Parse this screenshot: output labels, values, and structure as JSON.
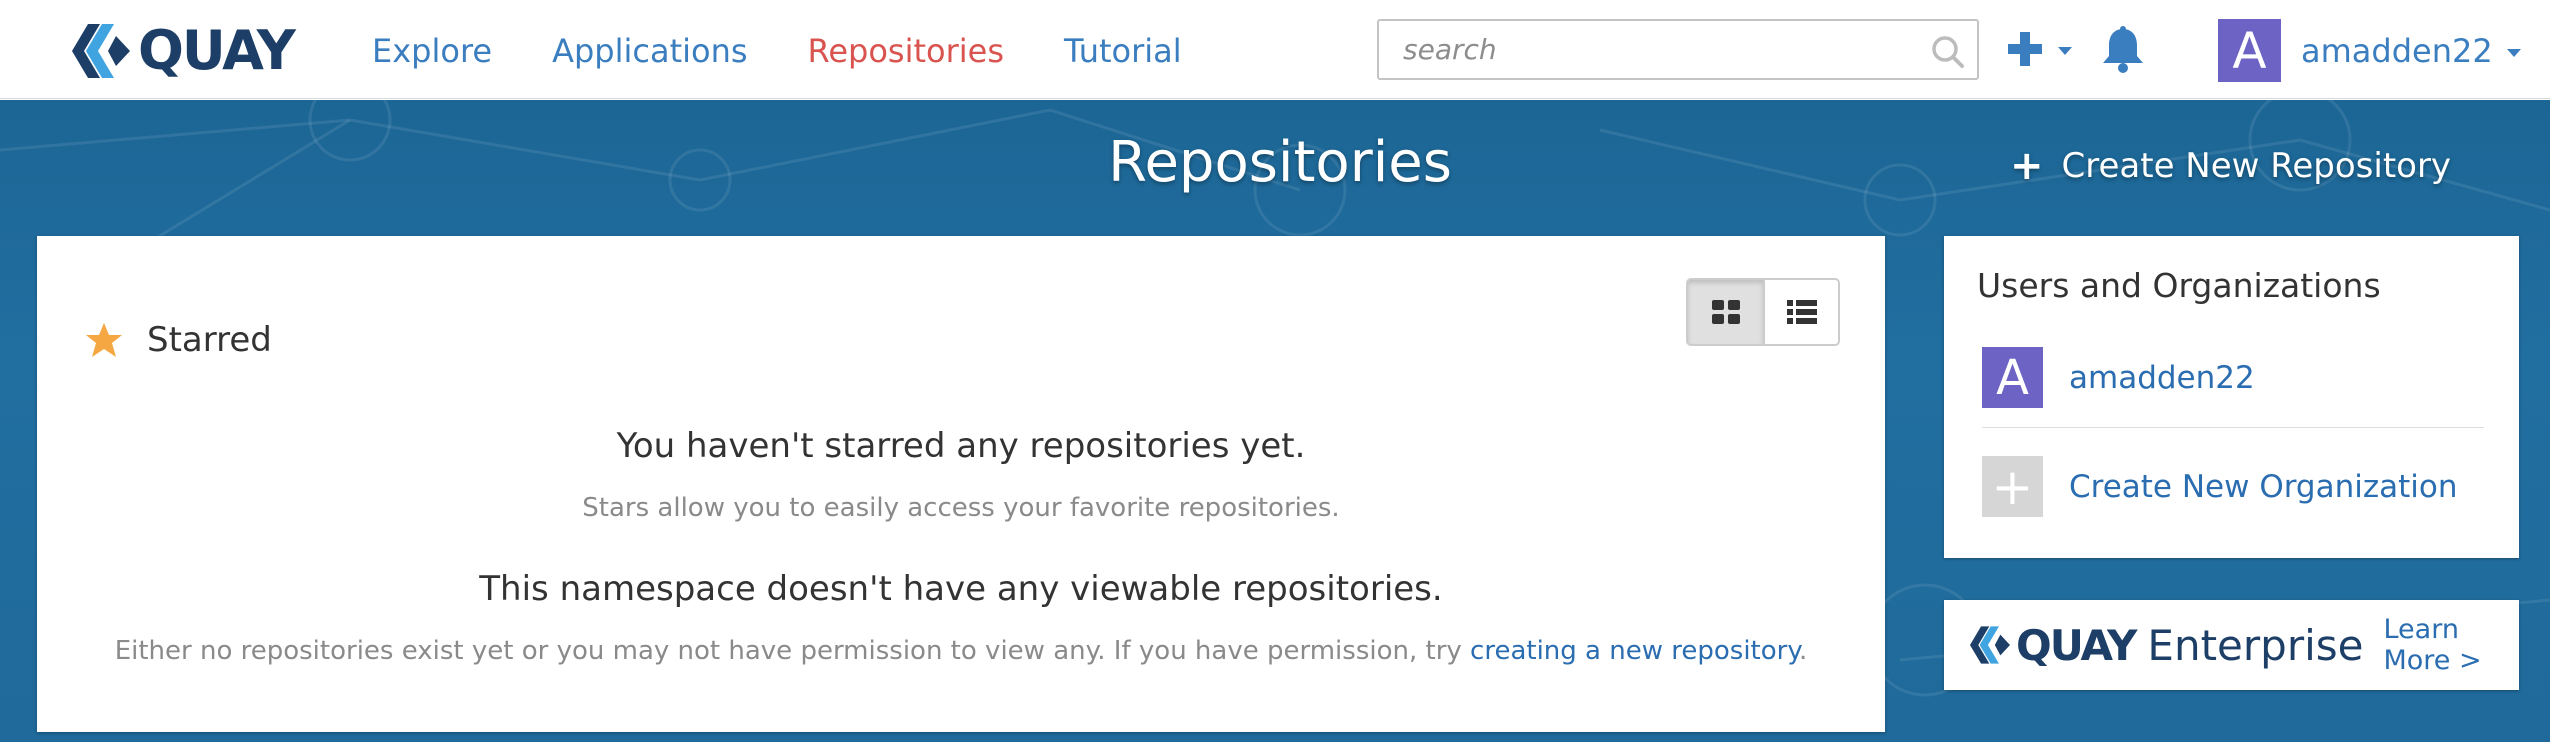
{
  "brand": {
    "name": "QUAY"
  },
  "nav": {
    "links": [
      {
        "label": "Explore",
        "active": false
      },
      {
        "label": "Applications",
        "active": false
      },
      {
        "label": "Repositories",
        "active": true
      },
      {
        "label": "Tutorial",
        "active": false
      }
    ],
    "active_color": "#d9534f",
    "link_color": "#3b7ec0"
  },
  "search": {
    "placeholder": "search",
    "value": ""
  },
  "user": {
    "initial": "A",
    "name": "amadden22",
    "avatar_color": "#6c63c5"
  },
  "page": {
    "title": "Repositories",
    "create_repo_label": "Create New Repository"
  },
  "starred": {
    "label": "Starred",
    "empty_title": "You haven't starred any repositories yet.",
    "empty_text": "Stars allow you to easily access your favorite repositories."
  },
  "namespace": {
    "empty_title": "This namespace doesn't have any viewable repositories.",
    "empty_text_before": "Either no repositories exist yet or you may not have permission to view any. If you have permission, try ",
    "empty_link": "creating a new repository",
    "empty_text_after": "."
  },
  "view_toggle": {
    "options": [
      "grid-icon",
      "list-icon"
    ],
    "selected": "grid"
  },
  "sidebar": {
    "title": "Users and Organizations",
    "items": [
      {
        "initial": "A",
        "label": "amadden22"
      },
      {
        "initial": "+",
        "label": "Create New Organization"
      }
    ]
  },
  "enterprise": {
    "brand": "QUAY",
    "word": "Enterprise",
    "cta": "Learn More  >"
  }
}
